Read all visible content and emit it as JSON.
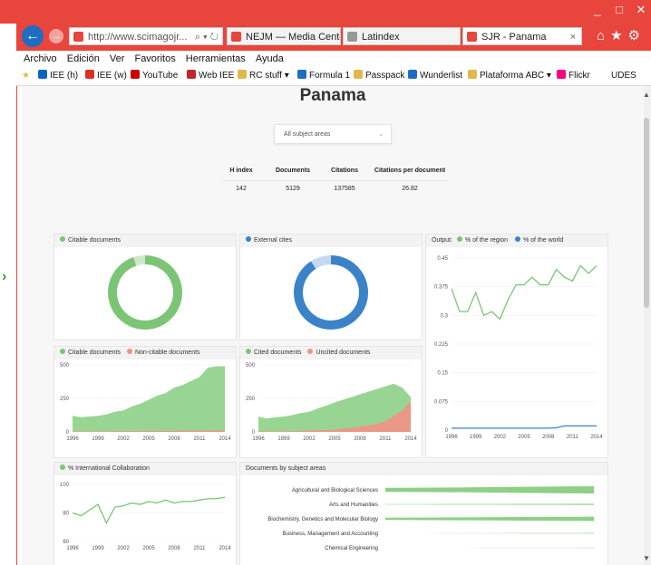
{
  "window": {
    "minimize_glyph": "_",
    "maximize_glyph": "□",
    "close_glyph": "✕",
    "toolbar_icons": [
      "home-icon",
      "star-icon",
      "gear-icon"
    ]
  },
  "nav": {
    "back_glyph": "←",
    "forward_glyph": "→",
    "address": "http://www.scimagojr... ",
    "address_controls": "⌕ ▾ ↻"
  },
  "tabs": [
    {
      "label": "NEJM — Media Center - ...",
      "icon_color": "#e8453c"
    },
    {
      "label": "Latindex",
      "icon_color": "#999999"
    },
    {
      "label": "SJR - Panama",
      "icon_color": "#e8453c",
      "close": "×"
    }
  ],
  "menu": [
    "Archivo",
    "Edición",
    "Ver",
    "Favoritos",
    "Herramientas",
    "Ayuda"
  ],
  "favorites": [
    {
      "label": "IEE (h)",
      "icon": "outlook-icon",
      "color": "#0a64c8"
    },
    {
      "label": "IEE (w)",
      "icon": "gmail-icon",
      "color": "#d93025"
    },
    {
      "label": "YouTube",
      "icon": "youtube-icon",
      "color": "#cc0000"
    },
    {
      "label": "Web IEE",
      "icon": "opera-icon",
      "color": "#c0262b"
    },
    {
      "label": "RC stuff ▾",
      "icon": "folder-icon",
      "color": "#e1b84a"
    },
    {
      "label": "Formula 1",
      "icon": "ie-icon",
      "color": "#1b6ec2"
    },
    {
      "label": "Passpack",
      "icon": "passpack-icon",
      "color": "#e1b84a"
    },
    {
      "label": "Wunderlist",
      "icon": "ie-icon",
      "color": "#1b6ec2"
    },
    {
      "label": "Plataforma ABC ▾",
      "icon": "folder-icon",
      "color": "#e1b84a"
    },
    {
      "label": "Flickr",
      "icon": "flickr-icon",
      "color": "#ff0084"
    },
    {
      "label": "UDES",
      "icon": "",
      "color": ""
    }
  ],
  "page": {
    "title": "Panama",
    "subject_select": "All subject areas",
    "stats": {
      "headers": [
        "H index",
        "Documents",
        "Citations",
        "Citations per document"
      ],
      "values": [
        "142",
        "5129",
        "137585",
        "26.82"
      ]
    }
  },
  "colors": {
    "green": "#7cc576",
    "green_dark": "#5db556",
    "blue": "#3a83c8",
    "salmon": "#f29186",
    "chrome_red": "#e8453c"
  },
  "panels": {
    "citable_docs": "Citable documents",
    "external_cites": "External cites",
    "output_title": "Output:",
    "output_region": "% of the region",
    "output_world": "% of the world",
    "citable_vs_non_a": "Citable documents",
    "citable_vs_non_b": "Non-citable documents",
    "cited_vs_uncited_a": "Cited documents",
    "cited_vs_uncited_b": "Uncited documents",
    "intl_collab": "% International Collaboration",
    "docs_by_subject": "Documents by subject areas"
  },
  "chart_data": [
    {
      "type": "pie",
      "title": "Citable documents",
      "values": [
        95,
        5
      ],
      "colors": [
        "#7cc576",
        "#cfe8cc"
      ]
    },
    {
      "type": "pie",
      "title": "External cites",
      "values": [
        91,
        9
      ],
      "colors": [
        "#3a83c8",
        "#c5daf0"
      ]
    },
    {
      "type": "line",
      "title": "Output",
      "x": [
        1996,
        1997,
        1998,
        1999,
        2000,
        2001,
        2002,
        2003,
        2004,
        2005,
        2006,
        2007,
        2008,
        2009,
        2010,
        2011,
        2012,
        2013,
        2014
      ],
      "series": [
        {
          "name": "% of the region",
          "values": [
            0.37,
            0.31,
            0.31,
            0.36,
            0.3,
            0.31,
            0.29,
            0.34,
            0.38,
            0.38,
            0.4,
            0.38,
            0.38,
            0.42,
            0.4,
            0.39,
            0.43,
            0.41,
            0.43
          ]
        },
        {
          "name": "% of the world",
          "values": [
            0.005,
            0.005,
            0.005,
            0.005,
            0.005,
            0.005,
            0.005,
            0.005,
            0.005,
            0.005,
            0.005,
            0.005,
            0.005,
            0.006,
            0.011,
            0.011,
            0.011,
            0.011,
            0.011
          ]
        }
      ],
      "yticks": [
        "0",
        "0.075",
        "0.15",
        "0.225",
        "0.3",
        "0.375",
        "0.45"
      ],
      "xticks": [
        "1996",
        "1999",
        "2002",
        "2005",
        "2008",
        "2011",
        "2014"
      ],
      "ylim": [
        0,
        0.45
      ]
    },
    {
      "type": "area",
      "title": "Citable vs non-citable documents",
      "x": [
        1996,
        1997,
        1998,
        1999,
        2000,
        2001,
        2002,
        2003,
        2004,
        2005,
        2006,
        2007,
        2008,
        2009,
        2010,
        2011,
        2012,
        2013,
        2014
      ],
      "series": [
        {
          "name": "Citable documents",
          "values": [
            120,
            110,
            115,
            120,
            130,
            150,
            160,
            190,
            210,
            240,
            270,
            290,
            330,
            350,
            380,
            410,
            480,
            490,
            490
          ]
        },
        {
          "name": "Non-citable documents",
          "values": [
            3,
            3,
            3,
            4,
            4,
            5,
            5,
            6,
            6,
            7,
            7,
            8,
            8,
            9,
            9,
            10,
            10,
            11,
            11
          ]
        }
      ],
      "yticks": [
        "0",
        "250",
        "500"
      ],
      "xticks": [
        "1996",
        "1999",
        "2002",
        "2005",
        "2008",
        "2011",
        "2014"
      ],
      "ylim": [
        0,
        500
      ]
    },
    {
      "type": "area",
      "title": "Cited vs uncited documents",
      "x": [
        1996,
        1997,
        1998,
        1999,
        2000,
        2001,
        2002,
        2003,
        2004,
        2005,
        2006,
        2007,
        2008,
        2009,
        2010,
        2011,
        2012,
        2013,
        2014
      ],
      "series": [
        {
          "name": "Cited documents",
          "values": [
            115,
            100,
            110,
            115,
            125,
            140,
            150,
            175,
            195,
            220,
            240,
            260,
            280,
            300,
            320,
            340,
            360,
            330,
            260
          ]
        },
        {
          "name": "Uncited documents",
          "values": [
            5,
            5,
            5,
            5,
            5,
            8,
            10,
            12,
            14,
            16,
            25,
            30,
            40,
            50,
            60,
            80,
            120,
            160,
            230
          ]
        }
      ],
      "yticks": [
        "0",
        "250",
        "500"
      ],
      "xticks": [
        "1996",
        "1999",
        "2002",
        "2005",
        "2008",
        "2011",
        "2014"
      ],
      "ylim": [
        0,
        500
      ]
    },
    {
      "type": "line",
      "title": "% International Collaboration",
      "x": [
        1996,
        1997,
        1998,
        1999,
        2000,
        2001,
        2002,
        2003,
        2004,
        2005,
        2006,
        2007,
        2008,
        2009,
        2010,
        2011,
        2012,
        2013,
        2014
      ],
      "series": [
        {
          "name": "% International Collaboration",
          "values": [
            80,
            78,
            82,
            86,
            73,
            84,
            85,
            87,
            86,
            88,
            87,
            89,
            87,
            88,
            88,
            89,
            90,
            90,
            91
          ]
        }
      ],
      "yticks": [
        "60",
        "80",
        "100"
      ],
      "xticks": [
        "1996",
        "1999",
        "2002",
        "2005",
        "2008",
        "2011",
        "2014"
      ],
      "ylim": [
        60,
        100
      ]
    },
    {
      "type": "area",
      "title": "Documents by subject areas",
      "categories": [
        "Agricultural and Biological Sciences",
        "Arts and Humanities",
        "Biochemistry, Genetics and Molecular Biology",
        "Business, Management and Accounting",
        "Chemical Engineering"
      ],
      "series": [
        {
          "name": "Agricultural and Biological Sciences",
          "values": [
            0.55,
            0.6,
            0.65,
            0.75,
            0.85,
            0.95,
            1.0
          ]
        },
        {
          "name": "Arts and Humanities",
          "values": [
            0.05,
            0.06,
            0.08,
            0.1,
            0.12,
            0.14,
            0.15
          ]
        },
        {
          "name": "Biochemistry, Genetics and Molecular Biology",
          "values": [
            0.3,
            0.35,
            0.4,
            0.45,
            0.5,
            0.55,
            0.6
          ]
        },
        {
          "name": "Business, Management and Accounting",
          "values": [
            0,
            0,
            0.02,
            0.03,
            0.05,
            0.06,
            0.08
          ]
        },
        {
          "name": "Chemical Engineering",
          "values": [
            0,
            0,
            0.01,
            0.02,
            0.03,
            0.04,
            0.05
          ]
        }
      ]
    }
  ]
}
